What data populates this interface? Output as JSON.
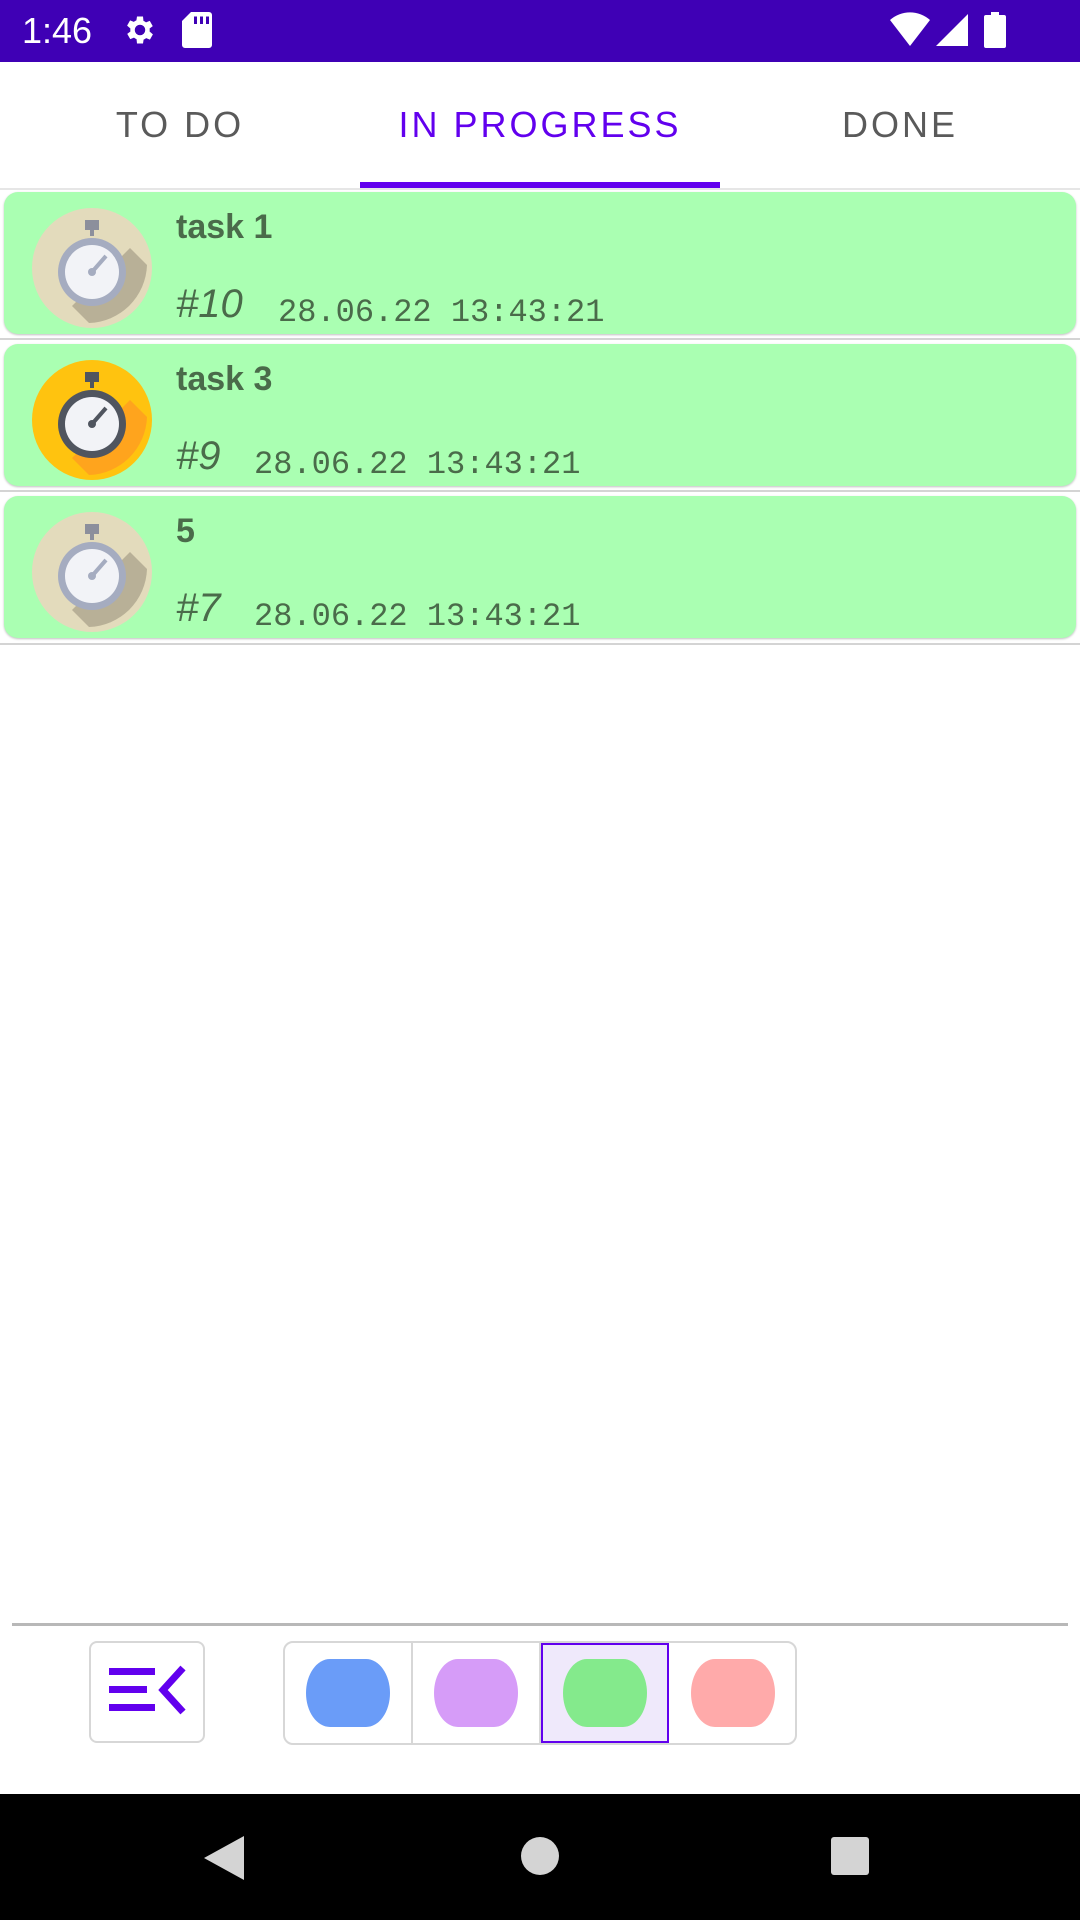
{
  "status_bar": {
    "time": "1:46",
    "icons": [
      "settings-icon",
      "sd-card-icon",
      "wifi-icon",
      "signal-icon",
      "battery-icon"
    ]
  },
  "tabs": [
    {
      "label": "TO DO",
      "active": false
    },
    {
      "label": "IN PROGRESS",
      "active": true
    },
    {
      "label": "DONE",
      "active": false
    }
  ],
  "tasks": [
    {
      "title": "task 1",
      "number": "#10",
      "date": "28.06.22 13:43:21",
      "icon": "stopwatch-icon-gray"
    },
    {
      "title": "task 3",
      "number": "#9",
      "date": "28.06.22 13:43:21",
      "icon": "stopwatch-icon-yellow"
    },
    {
      "title": "5",
      "number": "#7",
      "date": "28.06.22 13:43:21",
      "icon": "stopwatch-icon-gray"
    }
  ],
  "bottom_bar": {
    "menu_icon": "collapse-menu-icon",
    "color_options": [
      {
        "name": "blue",
        "color": "#6a9cf8",
        "selected": false
      },
      {
        "name": "purple",
        "color": "#d69cf8",
        "selected": false
      },
      {
        "name": "green",
        "color": "#84ea8c",
        "selected": true
      },
      {
        "name": "red",
        "color": "#ffaaaa",
        "selected": false
      }
    ]
  },
  "colors": {
    "accent": "#6200ee",
    "status_bar": "#3f00b5",
    "card_background": "#aaffb2"
  },
  "nav_bar": {
    "icons": [
      "back-icon",
      "home-icon",
      "recents-icon"
    ]
  }
}
